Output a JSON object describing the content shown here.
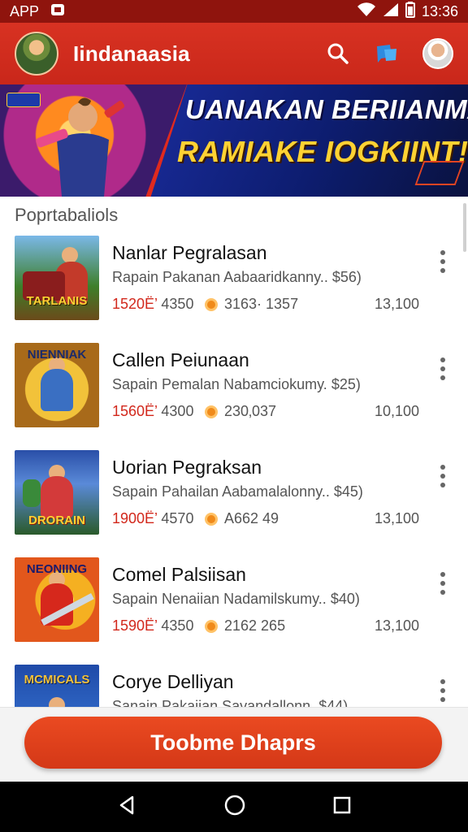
{
  "status_bar": {
    "app_label": "APP",
    "time": "13:36",
    "icons": [
      "notification-icon",
      "wifi-icon",
      "signal-icon",
      "battery-icon"
    ]
  },
  "app_bar": {
    "title": "Iindanaasia",
    "icons": [
      "search-icon",
      "chat-icon",
      "profile-avatar"
    ]
  },
  "banner": {
    "line1": "UANAKAN BERIIANMAN",
    "line2": "RAMIAKE IOGKIINT!",
    "badge": "",
    "colors": {
      "left": "#ff8a1f",
      "right": "#1a2c9c",
      "accent": "#ffd233"
    }
  },
  "section_title": "Poprtabaliols",
  "items": [
    {
      "title": "Nanlar Pegralasan",
      "subtitle": "Rapain Pakanan Aabaaridkanny..",
      "price": "$56)",
      "stat_red": "1520Ë’",
      "stat_a": "4350",
      "stat_b": "3163· 1357",
      "stat_c": "13,100",
      "thumb_label": "TARLANIS",
      "thumb_colors": [
        "#7bb8e8",
        "#c33a2a"
      ]
    },
    {
      "title": "Callen Peiunaan",
      "subtitle": "Sapain Pemalan Nabamciokumy.",
      "price": "$25)",
      "stat_red": "1560Ë’",
      "stat_a": "4300",
      "stat_b": "230‚037",
      "stat_c": "10,100",
      "thumb_label": "NIENNIAK",
      "thumb_colors": [
        "#f2c23a",
        "#3a6fc2"
      ]
    },
    {
      "title": "Uorian Pegraksan",
      "subtitle": "Sapain Pahailan Aabamalalonny..",
      "price": "$45)",
      "stat_red": "1900Ë’",
      "stat_a": "4570",
      "stat_b": "A662 49",
      "stat_c": "13,100",
      "thumb_label": "DRORAIN",
      "thumb_colors": [
        "#2a4fa8",
        "#e24a2a"
      ]
    },
    {
      "title": "Comel Palsiisan",
      "subtitle": "Sapain Nenaiian Nadamilskumy..",
      "price": "$40)",
      "stat_red": "1590Ë’",
      "stat_a": "4350",
      "stat_b": "2162 265",
      "stat_c": "13,100",
      "thumb_label": "NEONIING",
      "thumb_colors": [
        "#f5b021",
        "#d6281c"
      ]
    },
    {
      "title": "Corye Delliyan",
      "subtitle": "Sanain Pakaiian Savandallonn.",
      "price": "$44)",
      "stat_red": "",
      "stat_a": "",
      "stat_b": "",
      "stat_c": "",
      "thumb_label": "MCMICALS",
      "thumb_colors": [
        "#1f4aa8",
        "#f2c23a"
      ]
    }
  ],
  "cta": {
    "label": "Toobme Dhaprs"
  },
  "nav_bar": {
    "icons": [
      "back-icon",
      "home-icon",
      "recents-icon"
    ]
  }
}
